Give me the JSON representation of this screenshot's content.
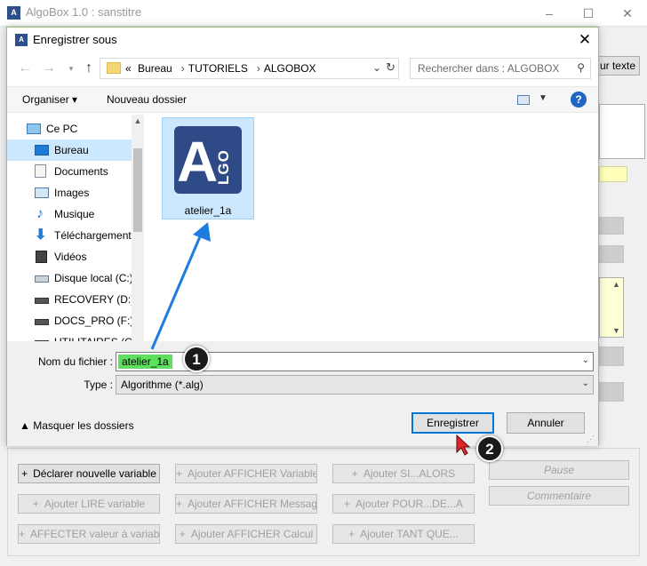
{
  "main_window": {
    "title": "AlgoBox 1.0 : sanstitre",
    "logo_text": "A",
    "minimize_glyph": "–",
    "maximize_glyph": "☐",
    "close_glyph": "✕",
    "right_button_label": "ur texte",
    "buttons": [
      {
        "label": "Déclarer nouvelle variable",
        "enabled": true
      },
      {
        "label": "Ajouter LIRE variable",
        "enabled": false
      },
      {
        "label": "AFFECTER valeur à variable",
        "enabled": false
      },
      {
        "label": "Ajouter AFFICHER Variable",
        "enabled": false
      },
      {
        "label": "Ajouter AFFICHER Message",
        "enabled": false
      },
      {
        "label": "Ajouter AFFICHER Calcul",
        "enabled": false
      },
      {
        "label": "Ajouter SI...ALORS",
        "enabled": false
      },
      {
        "label": "Ajouter POUR...DE...A",
        "enabled": false
      },
      {
        "label": "Ajouter TANT QUE...",
        "enabled": false
      },
      {
        "label": "Pause",
        "enabled": false
      },
      {
        "label": "Commentaire",
        "enabled": false
      }
    ]
  },
  "dialog": {
    "title": "Enregistrer sous",
    "close_glyph": "✕",
    "nav": {
      "back": "←",
      "forward": "→",
      "up": "↑"
    },
    "address": {
      "prefix": "«",
      "crumbs": [
        "Bureau",
        "TUTORIELS",
        "ALGOBOX"
      ],
      "separator": "›"
    },
    "search_placeholder": "Rechercher dans : ALGOBOX",
    "toolbar": {
      "organize": "Organiser ▾",
      "new_folder": "Nouveau dossier",
      "help": "?"
    },
    "nav_pane": [
      {
        "label": "Ce PC",
        "icon": "computer-icon",
        "selected": false
      },
      {
        "label": "Bureau",
        "icon": "desktop-icon",
        "selected": true
      },
      {
        "label": "Documents",
        "icon": "documents-icon",
        "selected": false
      },
      {
        "label": "Images",
        "icon": "images-icon",
        "selected": false
      },
      {
        "label": "Musique",
        "icon": "music-icon",
        "selected": false
      },
      {
        "label": "Téléchargements",
        "icon": "download-icon",
        "selected": false
      },
      {
        "label": "Vidéos",
        "icon": "video-icon",
        "selected": false
      },
      {
        "label": "Disque local (C:)",
        "icon": "disk-icon",
        "selected": false
      },
      {
        "label": "RECOVERY (D:)",
        "icon": "drive-icon",
        "selected": false
      },
      {
        "label": "DOCS_PRO (F:)",
        "icon": "drive-icon",
        "selected": false
      },
      {
        "label": "UTILITAIRES (G:)",
        "icon": "drive-icon",
        "selected": false
      }
    ],
    "file": {
      "name": "atelier_1a",
      "icon_letter": "A",
      "icon_letters_vertical": "LGO"
    },
    "filename_label": "Nom du fichier :",
    "filename_value": "atelier_1a",
    "type_label": "Type :",
    "type_value": "Algorithme (*.alg)",
    "hide_folders": "▲  Masquer les dossiers",
    "save_label": "Enregistrer",
    "cancel_label": "Annuler"
  },
  "annotations": {
    "step1": "1",
    "step2": "2",
    "accent_color": "#1e7be0"
  }
}
